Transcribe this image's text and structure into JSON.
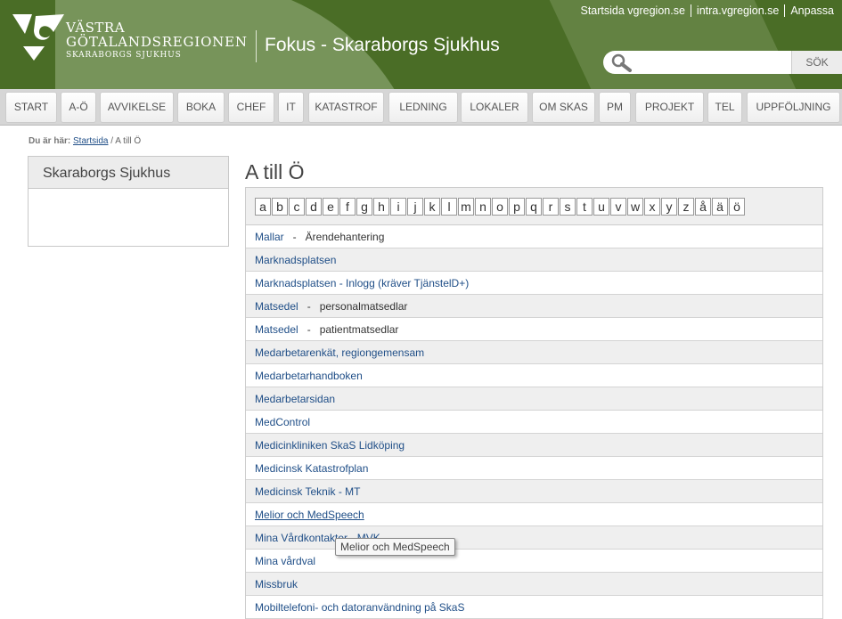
{
  "header": {
    "logo_line1": "VÄSTRA",
    "logo_line2": "GÖTALANDSREGIONEN",
    "logo_line3": "SKARABORGS SJUKHUS",
    "site_title": "Fokus - Skaraborgs Sjukhus",
    "top_links": [
      "Startsida vgregion.se",
      "intra.vgregion.se",
      "Anpassa"
    ],
    "search": {
      "placeholder": "",
      "button": "SÖK"
    }
  },
  "nav": [
    "START",
    "A-Ö",
    "AVVIKELSE",
    "BOKA",
    "CHEF",
    "IT",
    "KATASTROF",
    "LEDNING",
    "LOKALER",
    "OM SKAS",
    "PM",
    "PROJEKT",
    "TEL",
    "UPPFÖLJNING"
  ],
  "breadcrumb": {
    "label": "Du är här:",
    "home": "Startsida",
    "current": "/ A till Ö"
  },
  "sidebar": {
    "title": "Skaraborgs Sjukhus"
  },
  "main": {
    "title": "A till Ö",
    "letters": [
      "a",
      "b",
      "c",
      "d",
      "e",
      "f",
      "g",
      "h",
      "i",
      "j",
      "k",
      "l",
      "m",
      "n",
      "o",
      "p",
      "q",
      "r",
      "s",
      "t",
      "u",
      "v",
      "w",
      "x",
      "y",
      "z",
      "å",
      "ä",
      "ö"
    ],
    "items": [
      {
        "link": "Mallar",
        "desc": "Ärendehantering"
      },
      {
        "link": "Marknadsplatsen"
      },
      {
        "link": "Marknadsplatsen - Inlogg (kräver TjänstelD+)"
      },
      {
        "link": "Matsedel",
        "desc": "personalmatsedlar"
      },
      {
        "link": "Matsedel",
        "desc": "patientmatsedlar"
      },
      {
        "link": "Medarbetarenkät, regiongemensam"
      },
      {
        "link": "Medarbetarhandboken"
      },
      {
        "link": "Medarbetarsidan"
      },
      {
        "link": "MedControl"
      },
      {
        "link": "Medicinkliniken SkaS Lidköping"
      },
      {
        "link": "Medicinsk Katastrofplan"
      },
      {
        "link": "Medicinsk Teknik - MT"
      },
      {
        "link": "Melior och MedSpeech",
        "hovered": true
      },
      {
        "link": "Mina Vårdkontakter - MVK"
      },
      {
        "link": "Mina vårdval"
      },
      {
        "link": "Missbruk"
      },
      {
        "link": "Mobiltelefoni- och datoranvändning på SkaS"
      }
    ]
  },
  "tooltip": "Melior och MedSpeech",
  "colors": {
    "header_green": "#4a6d26",
    "link": "#1f4e87"
  }
}
